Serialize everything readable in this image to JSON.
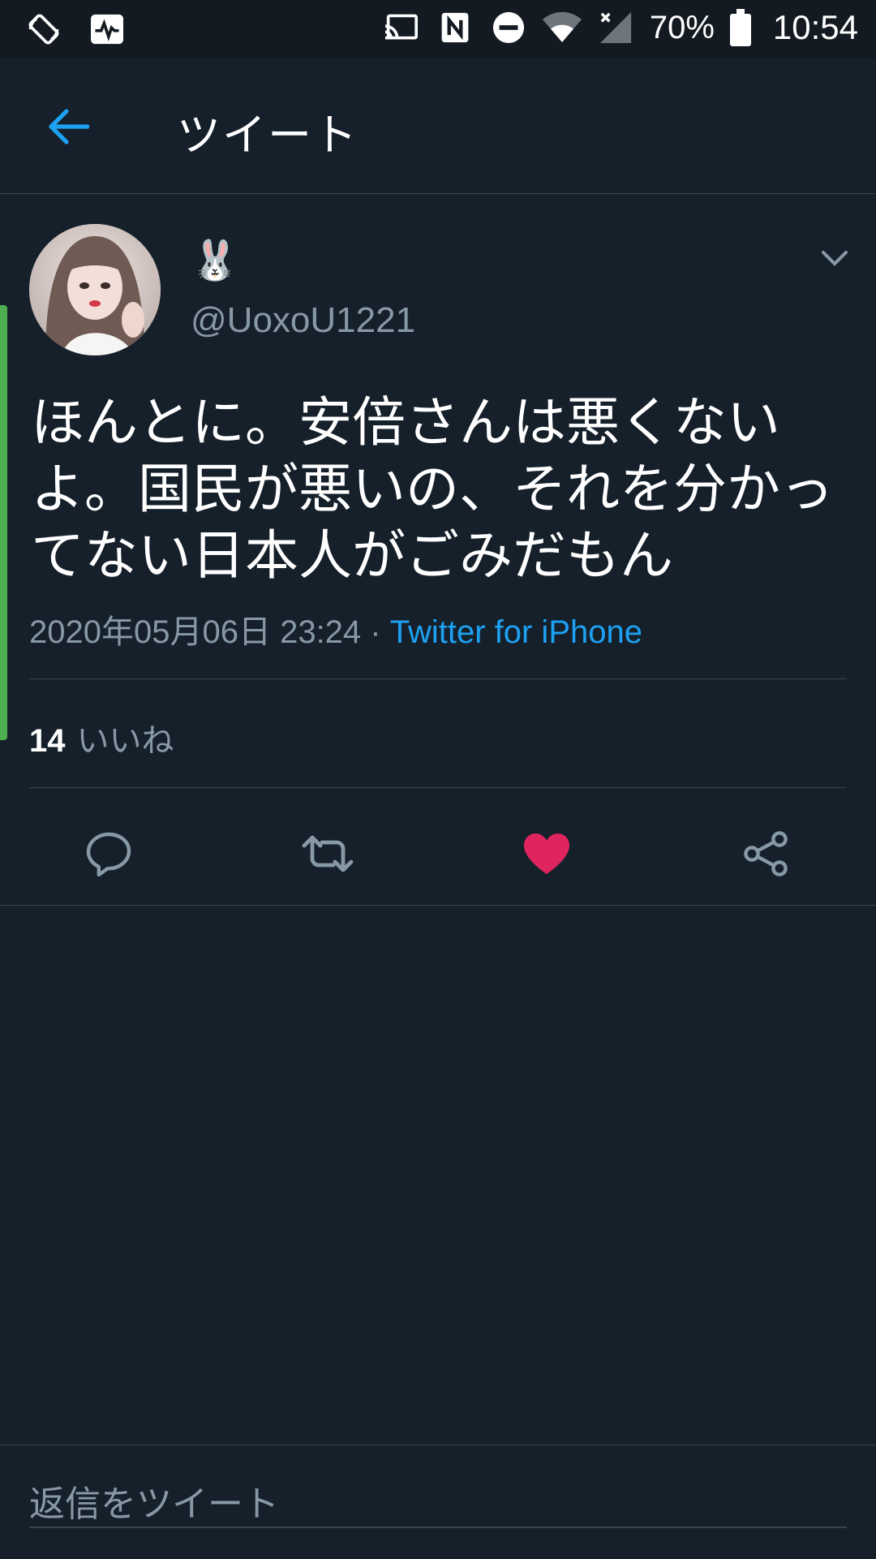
{
  "status_bar": {
    "icons_left": [
      "auto-rotate-icon",
      "activity-monitor-icon"
    ],
    "icons_right": [
      "cast-icon",
      "nfc-icon",
      "do-not-disturb-icon",
      "wifi-icon",
      "no-signal-icon",
      "battery-icon"
    ],
    "battery": "70%",
    "time": "10:54"
  },
  "header": {
    "title": "ツイート",
    "back_icon": "back-arrow-icon"
  },
  "tweet": {
    "display_name": "🐰",
    "handle": "@UoxoU1221",
    "text": "ほんとに。安倍さんは悪くないよ。国民が悪いの、それを分かってない日本人がごみだもん",
    "timestamp": "2020年05月06日 23:24",
    "separator": " · ",
    "source": "Twitter for iPhone",
    "likes_count": "14",
    "likes_label": "いいね",
    "liked": true
  },
  "actions": [
    "reply-icon",
    "retweet-icon",
    "like-icon",
    "share-icon"
  ],
  "reply_bar": {
    "placeholder": "返信をツイート"
  },
  "colors": {
    "background": "#15202b",
    "accent": "#1da1f2",
    "like": "#e0245e",
    "secondary_text": "#8899a6",
    "thread_line": "#4caf50"
  }
}
